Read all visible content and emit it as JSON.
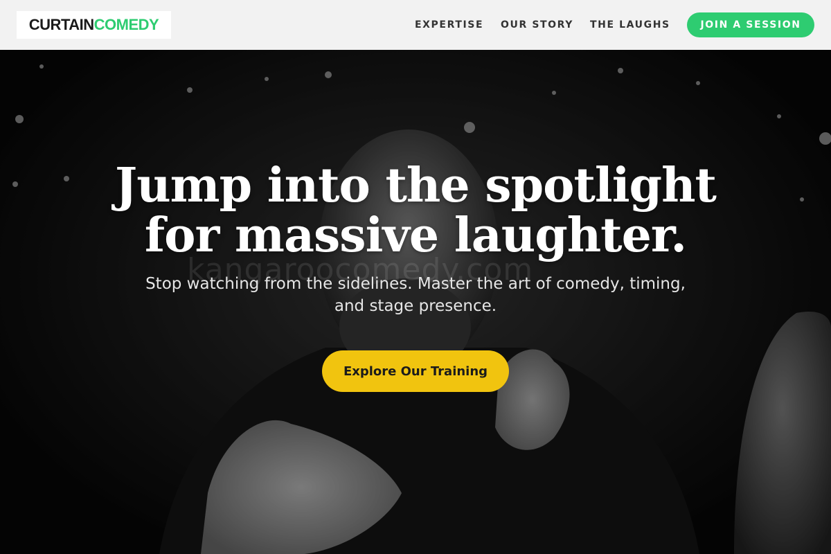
{
  "header": {
    "logo": {
      "part_a": "CURTAIN",
      "part_b": "COMEDY"
    },
    "nav": {
      "expertise": "EXPERTISE",
      "our_story": "OUR STORY",
      "the_laughs": "THE LAUGHS"
    },
    "cta_label": "JOIN A SESSION"
  },
  "hero": {
    "title_line_1": "Jump into the spotlight",
    "title_line_2": "for massive laughter.",
    "subtitle": "Stop watching from the sidelines. Master the art of comedy, timing, and stage presence.",
    "cta_label": "Explore Our Training",
    "watermark": "kangaroocomedy.com"
  },
  "colors": {
    "header_bg": "#f2f2f2",
    "brand_green": "#2ecc71",
    "cta_yellow": "#f1c40f",
    "nav_text": "#333333"
  }
}
